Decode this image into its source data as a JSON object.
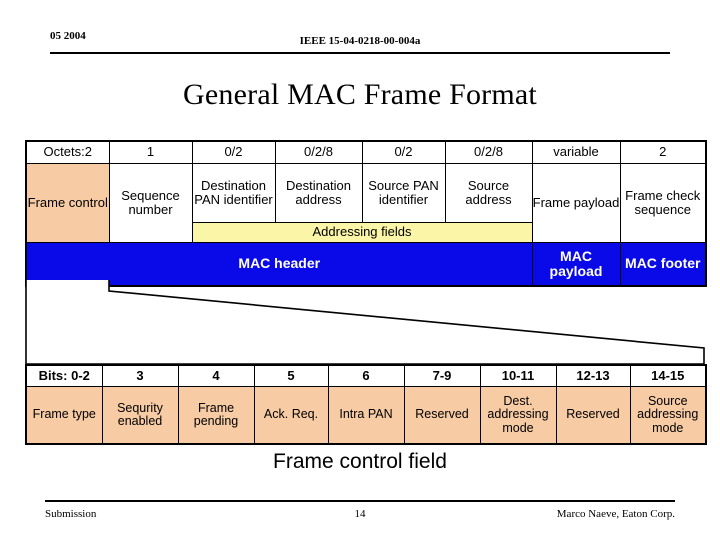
{
  "header": {
    "date": "05 2004",
    "doc_id": "IEEE 15-04-0218-00-004a"
  },
  "title": "General MAC Frame Format",
  "mac_frame": {
    "octets_label": "Octets:2",
    "octets": [
      "Octets:2",
      "1",
      "0/2",
      "0/2/8",
      "0/2",
      "0/2/8",
      "variable",
      "2"
    ],
    "fields": [
      "Frame control",
      "Sequence number",
      "Destination PAN identifier",
      "Destination address",
      "Source PAN identifier",
      "Source address",
      "Frame payload",
      "Frame check sequence"
    ],
    "addressing_band": "Addressing fields",
    "mac_header": "MAC header",
    "mac_payload": "MAC payload",
    "mac_footer": "MAC footer"
  },
  "frame_control": {
    "bits": [
      "Bits: 0-2",
      "3",
      "4",
      "5",
      "6",
      "7-9",
      "10-11",
      "12-13",
      "14-15"
    ],
    "names": [
      "Frame type",
      "Sequrity enabled",
      "Frame pending",
      "Ack. Req.",
      "Intra PAN",
      "Reserved",
      "Dest. addressing mode",
      "Reserved",
      "Source addressing mode"
    ]
  },
  "caption": "Frame control field",
  "footer": {
    "left": "Submission",
    "page": "14",
    "right": "Marco Naeve, Eaton Corp."
  },
  "colors": {
    "frame_control_fill": "#F7CBA4",
    "addressing_fill": "#FBF5A8",
    "mac_band_fill": "#0A0AE8",
    "mac_band_text": "#FFFFFF",
    "border": "#000000",
    "background": "#FFFFFF"
  }
}
